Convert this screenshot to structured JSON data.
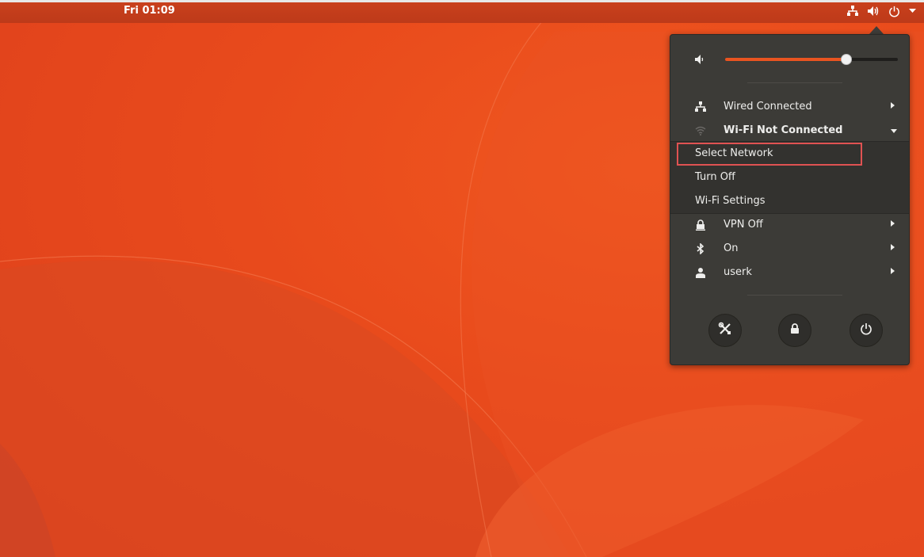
{
  "topbar": {
    "clock": "Fri 01:09",
    "tray_icons": [
      "network-wired-icon",
      "volume-icon",
      "power-icon",
      "chevron-down-icon"
    ]
  },
  "menu": {
    "volume": {
      "icon": "volume-muted-icon",
      "level": 0.7
    },
    "wired": {
      "label": "Wired Connected",
      "icon": "network-wired-icon"
    },
    "wifi": {
      "label": "Wi-Fi Not Connected",
      "icon": "wifi-icon",
      "submenu": [
        "Select Network",
        "Turn Off",
        "Wi-Fi Settings"
      ],
      "highlighted": "Select Network"
    },
    "vpn": {
      "label": "VPN Off",
      "icon": "vpn-lock-icon"
    },
    "bluetooth": {
      "label": "On",
      "icon": "bluetooth-icon"
    },
    "user": {
      "label": "userk",
      "icon": "user-icon"
    },
    "buttons": [
      "settings-icon",
      "lock-icon",
      "power-icon"
    ]
  },
  "colors": {
    "accent": "#e95420",
    "menu_bg": "#3c3b37",
    "desktop": "#e84a1c",
    "highlight_border": "#e05252"
  }
}
